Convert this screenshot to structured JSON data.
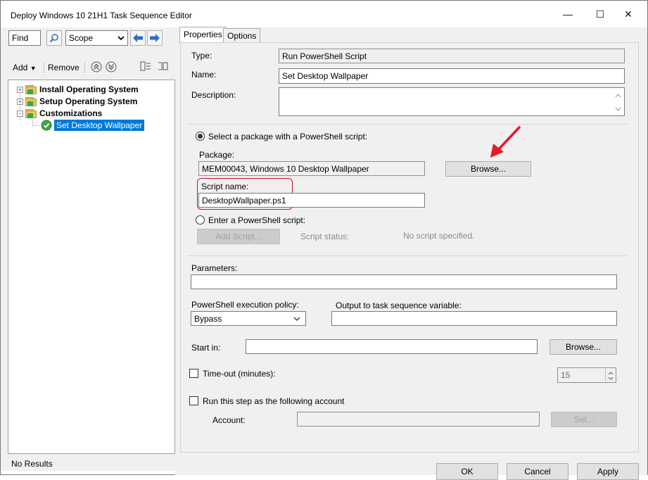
{
  "window": {
    "title": "Deploy Windows 10 21H1 Task Sequence Editor",
    "controls": {
      "minimize": "—",
      "maximize": "☐",
      "close": "✕"
    }
  },
  "left": {
    "find_value": "Find",
    "scope_label": "Scope",
    "add_label": "Add",
    "remove_label": "Remove",
    "tree": [
      {
        "label": "Install Operating System",
        "bold": true
      },
      {
        "label": "Setup Operating System",
        "bold": true
      },
      {
        "label": "Customizations",
        "bold": true
      },
      {
        "label": "Set Desktop Wallpaper",
        "bold": false,
        "selected": true
      }
    ],
    "status": "No Results"
  },
  "tabs": [
    {
      "label": "Properties"
    },
    {
      "label": "Options"
    }
  ],
  "props": {
    "type_label": "Type:",
    "type_value": "Run PowerShell Script",
    "name_label": "Name:",
    "name_value": "Set Desktop Wallpaper",
    "description_label": "Description:",
    "description_value": "",
    "radio_package_label": "Select a package with a PowerShell script:",
    "package_label": "Package:",
    "package_value": "MEM00043, Windows 10 Desktop Wallpaper",
    "browse_label": "Browse...",
    "script_name_label": "Script name:",
    "script_name_value": "DesktopWallpaper.ps1",
    "radio_enter_label": "Enter a PowerShell script:",
    "add_script_label": "Add Script...",
    "script_status_label": "Script status:",
    "script_status_value": "No script specified.",
    "parameters_label": "Parameters:",
    "parameters_value": "",
    "policy_label": "PowerShell execution policy:",
    "policy_value": "Bypass",
    "output_label": "Output to task sequence variable:",
    "output_value": "",
    "start_in_label": "Start in:",
    "start_in_value": "",
    "browse2_label": "Browse...",
    "timeout_label": "Time-out (minutes):",
    "timeout_value": "15",
    "run_as_label": "Run this step as the following account",
    "account_label": "Account:",
    "account_value": "",
    "set_label": "Set..."
  },
  "footer": {
    "ok": "OK",
    "cancel": "Cancel",
    "apply": "Apply"
  },
  "colors": {
    "selection": "#0078d7",
    "annotation": "#e31b23"
  }
}
